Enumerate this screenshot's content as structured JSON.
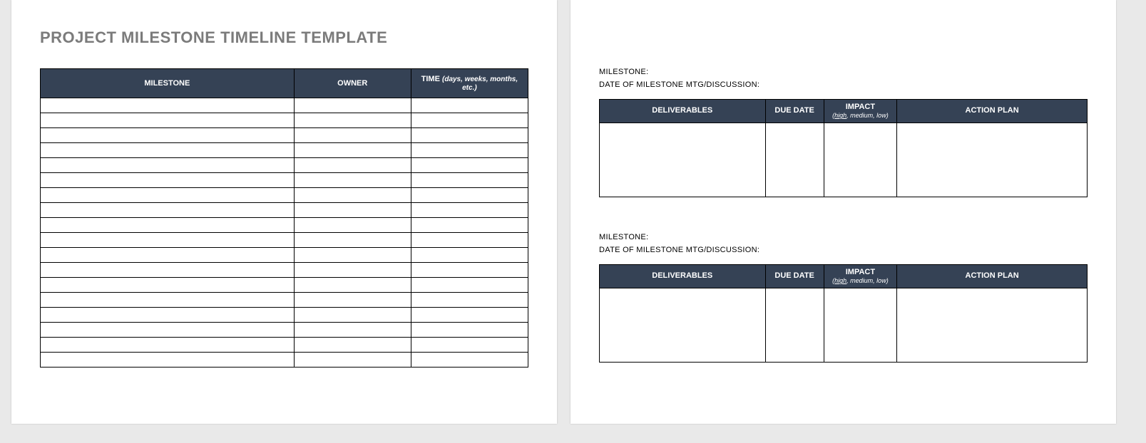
{
  "title": "PROJECT MILESTONE TIMELINE TEMPLATE",
  "main_table": {
    "headers": {
      "milestone": "MILESTONE",
      "owner": "OWNER",
      "time": "TIME",
      "time_sub": "(days, weeks, months, etc.)"
    },
    "row_count": 18
  },
  "detail": {
    "milestone_label": "MILESTONE:",
    "date_label": "DATE OF MILESTONE MTG/DISCUSSION:",
    "headers": {
      "deliverables": "DELIVERABLES",
      "due_date": "DUE DATE",
      "impact": "IMPACT",
      "impact_sub_high": "high",
      "impact_sub_rest": ", medium, low)",
      "impact_sub_open": "(",
      "action_plan": "ACTION PLAN"
    },
    "blocks": [
      {
        "milestone_value": "",
        "date_value": "",
        "deliverables": "",
        "due_date": "",
        "impact": "",
        "action_plan": ""
      },
      {
        "milestone_value": "",
        "date_value": "",
        "deliverables": "",
        "due_date": "",
        "impact": "",
        "action_plan": ""
      }
    ]
  }
}
